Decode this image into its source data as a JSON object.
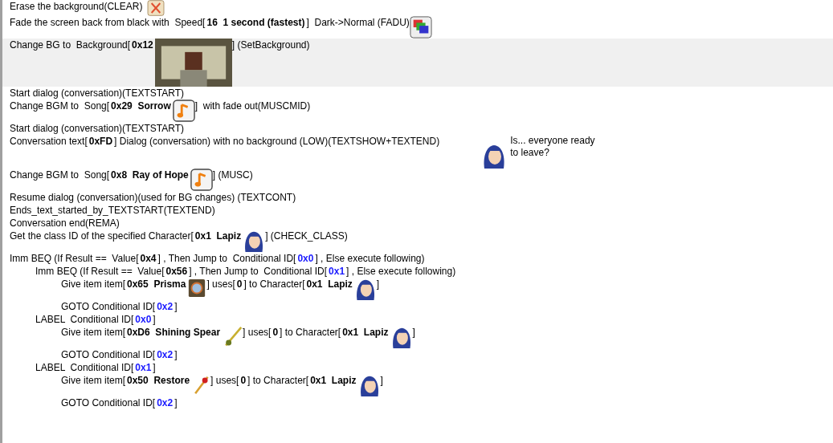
{
  "rows": [
    {
      "selected": false,
      "parts": [
        {
          "kind": "text",
          "text": "Erase the background(CLEAR)"
        },
        {
          "kind": "erase"
        }
      ]
    },
    {
      "selected": false,
      "parts": [
        {
          "kind": "text",
          "text": "Fade the screen back from black with  Speed["
        },
        {
          "kind": "bold",
          "text": "16  1 second (fastest)"
        },
        {
          "kind": "text",
          "text": "]  Dark->Normal (FADU)"
        },
        {
          "kind": "fade"
        }
      ]
    },
    {
      "selected": true,
      "parts": [
        {
          "kind": "text",
          "text": "Change BG to  Background["
        },
        {
          "kind": "bold",
          "text": "0x12"
        },
        {
          "kind": "background"
        },
        {
          "kind": "text",
          "text": "] (SetBackground)"
        }
      ]
    },
    {
      "selected": false,
      "parts": [
        {
          "kind": "text",
          "text": "Start dialog (conversation)(TEXTSTART)"
        }
      ]
    },
    {
      "selected": false,
      "parts": [
        {
          "kind": "text",
          "text": "Change BGM to  Song["
        },
        {
          "kind": "bold",
          "text": "0x29  Sorrow"
        },
        {
          "kind": "music"
        },
        {
          "kind": "text",
          "text": "]  with fade out(MUSCMID)"
        }
      ]
    },
    {
      "selected": false,
      "parts": [
        {
          "kind": "text",
          "text": "Start dialog (conversation)(TEXTSTART)"
        }
      ]
    },
    {
      "selected": false,
      "parts": [
        {
          "kind": "text",
          "text": "Conversation text["
        },
        {
          "kind": "bold",
          "text": "0xFD"
        },
        {
          "kind": "text",
          "text": "] Dialog (conversation) with no background (LOW)(TEXTSHOW+TEXTEND)"
        },
        {
          "kind": "dialog",
          "text": "Is... everyone ready to leave?"
        }
      ]
    },
    {
      "selected": false,
      "parts": [
        {
          "kind": "text",
          "text": "Change BGM to  Song["
        },
        {
          "kind": "bold",
          "text": "0x8  Ray of Hope"
        },
        {
          "kind": "music"
        },
        {
          "kind": "text",
          "text": "] (MUSC)"
        }
      ]
    },
    {
      "selected": false,
      "parts": [
        {
          "kind": "text",
          "text": "Resume dialog (conversation)(used for BG changes) (TEXTCONT)"
        }
      ]
    },
    {
      "selected": false,
      "parts": [
        {
          "kind": "text",
          "text": "Ends_text_started_by_TEXTSTART(TEXTEND)"
        }
      ]
    },
    {
      "selected": false,
      "parts": [
        {
          "kind": "text",
          "text": "Conversation end(REMA)"
        }
      ]
    },
    {
      "selected": false,
      "parts": [
        {
          "kind": "text",
          "text": "Get the class ID of the specified Character["
        },
        {
          "kind": "bold",
          "text": "0x1  Lapiz"
        },
        {
          "kind": "portrait"
        },
        {
          "kind": "text",
          "text": "] (CHECK_CLASS)"
        }
      ]
    },
    {
      "selected": false,
      "parts": [
        {
          "kind": "text",
          "text": "Imm BEQ (If Result ==  Value["
        },
        {
          "kind": "bold",
          "text": "0x4"
        },
        {
          "kind": "text",
          "text": "] , Then Jump to  Conditional ID["
        },
        {
          "kind": "id",
          "text": "0x0"
        },
        {
          "kind": "text",
          "text": "] , Else execute following)"
        }
      ],
      "children": [
        {
          "selected": false,
          "parts": [
            {
              "kind": "text",
              "text": "Imm BEQ (If Result ==  Value["
            },
            {
              "kind": "bold",
              "text": "0x56"
            },
            {
              "kind": "text",
              "text": "] , Then Jump to  Conditional ID["
            },
            {
              "kind": "id",
              "text": "0x1"
            },
            {
              "kind": "text",
              "text": "] , Else execute following)"
            }
          ],
          "children": [
            {
              "selected": false,
              "parts": [
                {
                  "kind": "text",
                  "text": "Give item item["
                },
                {
                  "kind": "bold",
                  "text": "0x65  Prisma"
                },
                {
                  "kind": "tome"
                },
                {
                  "kind": "text",
                  "text": "] uses["
                },
                {
                  "kind": "bold",
                  "text": "0"
                },
                {
                  "kind": "text",
                  "text": "] to Character["
                },
                {
                  "kind": "bold",
                  "text": "0x1  Lapiz"
                },
                {
                  "kind": "portrait"
                },
                {
                  "kind": "text",
                  "text": "]"
                }
              ]
            },
            {
              "selected": false,
              "parts": [
                {
                  "kind": "text",
                  "text": "GOTO Conditional ID["
                },
                {
                  "kind": "id",
                  "text": "0x2"
                },
                {
                  "kind": "text",
                  "text": "]"
                }
              ]
            }
          ]
        },
        {
          "selected": false,
          "parts": [
            {
              "kind": "text",
              "text": "LABEL  Conditional ID["
            },
            {
              "kind": "id",
              "text": "0x0"
            },
            {
              "kind": "text",
              "text": "]"
            }
          ],
          "children": [
            {
              "selected": false,
              "parts": [
                {
                  "kind": "text",
                  "text": "Give item item["
                },
                {
                  "kind": "bold",
                  "text": "0xD6  Shining Spear"
                },
                {
                  "kind": "spear"
                },
                {
                  "kind": "text",
                  "text": "] uses["
                },
                {
                  "kind": "bold",
                  "text": "0"
                },
                {
                  "kind": "text",
                  "text": "] to Character["
                },
                {
                  "kind": "bold",
                  "text": "0x1  Lapiz"
                },
                {
                  "kind": "portrait"
                },
                {
                  "kind": "text",
                  "text": "]"
                }
              ]
            },
            {
              "selected": false,
              "parts": [
                {
                  "kind": "text",
                  "text": "GOTO Conditional ID["
                },
                {
                  "kind": "id",
                  "text": "0x2"
                },
                {
                  "kind": "text",
                  "text": "]"
                }
              ]
            }
          ]
        },
        {
          "selected": false,
          "parts": [
            {
              "kind": "text",
              "text": "LABEL  Conditional ID["
            },
            {
              "kind": "id",
              "text": "0x1"
            },
            {
              "kind": "text",
              "text": "]"
            }
          ],
          "children": [
            {
              "selected": false,
              "parts": [
                {
                  "kind": "text",
                  "text": "Give item item["
                },
                {
                  "kind": "bold",
                  "text": "0x50  Restore"
                },
                {
                  "kind": "staff"
                },
                {
                  "kind": "text",
                  "text": "] uses["
                },
                {
                  "kind": "bold",
                  "text": "0"
                },
                {
                  "kind": "text",
                  "text": "] to Character["
                },
                {
                  "kind": "bold",
                  "text": "0x1  Lapiz"
                },
                {
                  "kind": "portrait"
                },
                {
                  "kind": "text",
                  "text": "]"
                }
              ]
            },
            {
              "selected": false,
              "parts": [
                {
                  "kind": "text",
                  "text": "GOTO Conditional ID["
                },
                {
                  "kind": "id",
                  "text": "0x2"
                },
                {
                  "kind": "text",
                  "text": "]"
                }
              ]
            }
          ]
        }
      ]
    }
  ]
}
